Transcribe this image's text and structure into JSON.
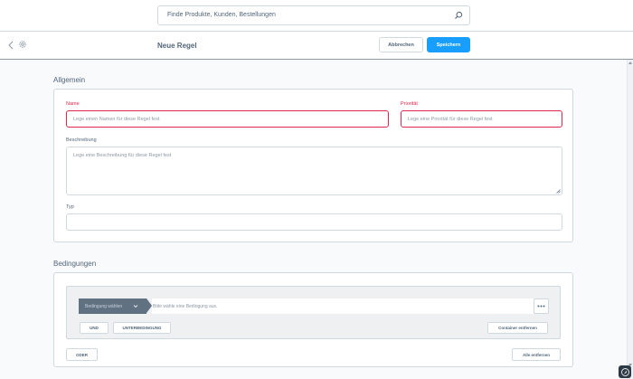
{
  "header": {
    "search_placeholder": "Finde Produkte, Kunden, Bestellungen"
  },
  "toolbar": {
    "title": "Neue Regel",
    "cancel_label": "Abbrechen",
    "save_label": "Speichern"
  },
  "general": {
    "section_title": "Allgemein",
    "name_label": "Name",
    "name_placeholder": "Lege einen Namen für diese Regel fest",
    "priority_label": "Priorität",
    "priority_placeholder": "Lege eine Priorität für diese Regel fest",
    "description_label": "Beschreibung",
    "description_placeholder": "Lege eine Beschreibung für diese Regel fest",
    "type_label": "Typ",
    "type_value": ""
  },
  "conditions": {
    "section_title": "Bedingungen",
    "select_label": "Bedingung wählen",
    "field_placeholder": "Bitte wähle eine Bedingung aus.",
    "and_label": "UND",
    "subcondition_label": "UNTERBEDINGUNG",
    "remove_container_label": "Container entfernen",
    "or_label": "ODER",
    "remove_all_label": "Alle entfernen"
  },
  "colors": {
    "primary": "#189eff",
    "error": "#de294c",
    "text": "#52667a",
    "border": "#d1d9e0"
  },
  "icons": [
    "search-icon",
    "back-icon",
    "gear-icon",
    "chevron-down-icon",
    "more-icon",
    "resize-icon",
    "brand-icon"
  ]
}
